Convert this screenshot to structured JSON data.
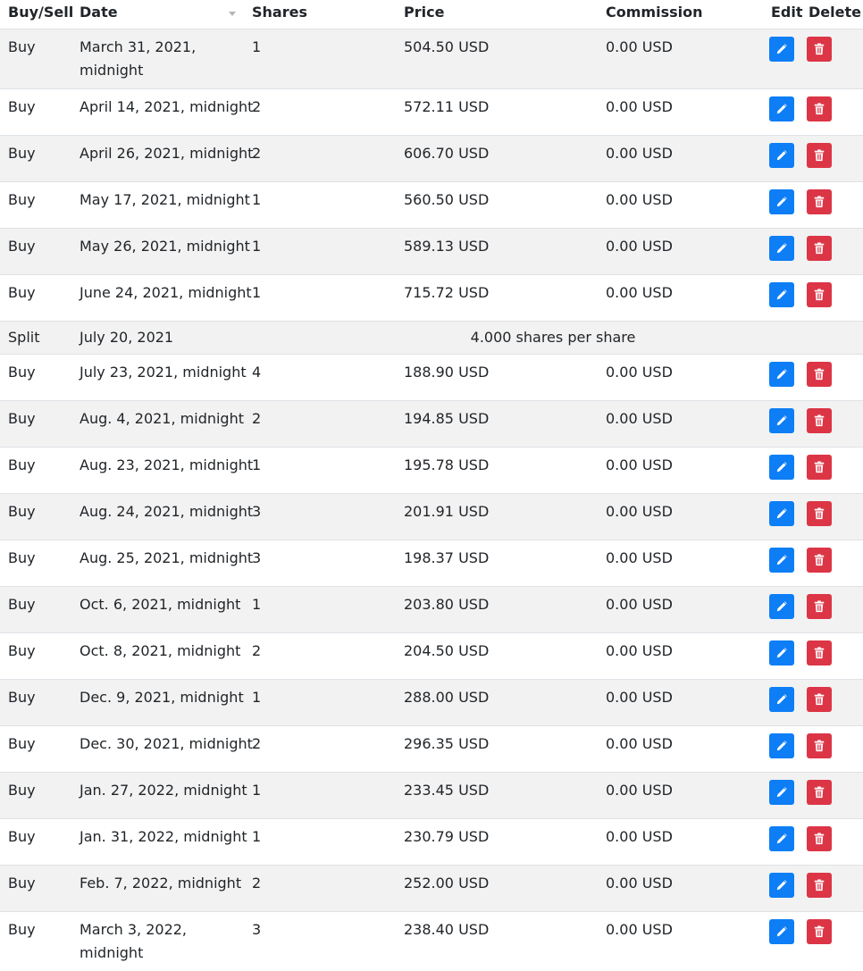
{
  "headers": {
    "buy_sell": "Buy/Sell",
    "date": "Date",
    "shares": "Shares",
    "price": "Price",
    "commission": "Commission",
    "edit": "Edit",
    "delete": "Delete"
  },
  "rows": [
    {
      "type": "Buy",
      "date": "March 31, 2021, midnight",
      "shares": "1",
      "price": "504.50 USD",
      "commission": "0.00 USD"
    },
    {
      "type": "Buy",
      "date": "April 14, 2021, midnight",
      "shares": "2",
      "price": "572.11 USD",
      "commission": "0.00 USD"
    },
    {
      "type": "Buy",
      "date": "April 26, 2021, midnight",
      "shares": "2",
      "price": "606.70 USD",
      "commission": "0.00 USD"
    },
    {
      "type": "Buy",
      "date": "May 17, 2021, midnight",
      "shares": "1",
      "price": "560.50 USD",
      "commission": "0.00 USD"
    },
    {
      "type": "Buy",
      "date": "May 26, 2021, midnight",
      "shares": "1",
      "price": "589.13 USD",
      "commission": "0.00 USD"
    },
    {
      "type": "Buy",
      "date": "June 24, 2021, midnight",
      "shares": "1",
      "price": "715.72 USD",
      "commission": "0.00 USD"
    },
    {
      "type": "Split",
      "date": "July 20, 2021",
      "ratio": "4.000 shares per share"
    },
    {
      "type": "Buy",
      "date": "July 23, 2021, midnight",
      "shares": "4",
      "price": "188.90 USD",
      "commission": "0.00 USD"
    },
    {
      "type": "Buy",
      "date": "Aug. 4, 2021, midnight",
      "shares": "2",
      "price": "194.85 USD",
      "commission": "0.00 USD"
    },
    {
      "type": "Buy",
      "date": "Aug. 23, 2021, midnight",
      "shares": "1",
      "price": "195.78 USD",
      "commission": "0.00 USD"
    },
    {
      "type": "Buy",
      "date": "Aug. 24, 2021, midnight",
      "shares": "3",
      "price": "201.91 USD",
      "commission": "0.00 USD"
    },
    {
      "type": "Buy",
      "date": "Aug. 25, 2021, midnight",
      "shares": "3",
      "price": "198.37 USD",
      "commission": "0.00 USD"
    },
    {
      "type": "Buy",
      "date": "Oct. 6, 2021, midnight",
      "shares": "1",
      "price": "203.80 USD",
      "commission": "0.00 USD"
    },
    {
      "type": "Buy",
      "date": "Oct. 8, 2021, midnight",
      "shares": "2",
      "price": "204.50 USD",
      "commission": "0.00 USD"
    },
    {
      "type": "Buy",
      "date": "Dec. 9, 2021, midnight",
      "shares": "1",
      "price": "288.00 USD",
      "commission": "0.00 USD"
    },
    {
      "type": "Buy",
      "date": "Dec. 30, 2021, midnight",
      "shares": "2",
      "price": "296.35 USD",
      "commission": "0.00 USD"
    },
    {
      "type": "Buy",
      "date": "Jan. 27, 2022, midnight",
      "shares": "1",
      "price": "233.45 USD",
      "commission": "0.00 USD"
    },
    {
      "type": "Buy",
      "date": "Jan. 31, 2022, midnight",
      "shares": "1",
      "price": "230.79 USD",
      "commission": "0.00 USD"
    },
    {
      "type": "Buy",
      "date": "Feb. 7, 2022, midnight",
      "shares": "2",
      "price": "252.00 USD",
      "commission": "0.00 USD"
    },
    {
      "type": "Buy",
      "date": "March 3, 2022, midnight",
      "shares": "3",
      "price": "238.40 USD",
      "commission": "0.00 USD"
    }
  ],
  "icons": {
    "edit": "pencil-icon",
    "delete": "trash-icon",
    "sort": "sort-caret-icon"
  },
  "colors": {
    "edit_button": "#0d7ef5",
    "delete_button": "#dc3545",
    "stripe": "#f2f2f2",
    "border": "#dee2e6"
  }
}
